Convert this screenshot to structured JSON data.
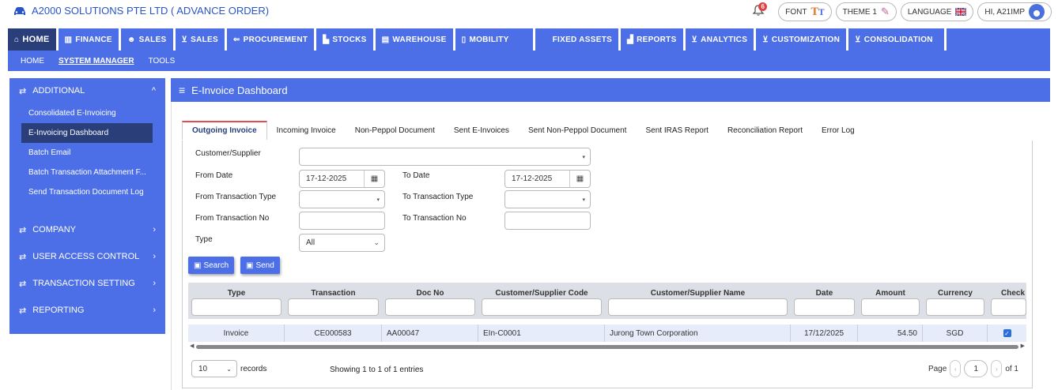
{
  "header": {
    "company": "A2000 SOLUTIONS PTE LTD ( ADVANCE ORDER)",
    "notification_count": "6",
    "font_label": "FONT",
    "theme_label": "THEME 1",
    "language_label": "LANGUAGE",
    "user_label": "HI, A21IMP"
  },
  "mainnav": [
    {
      "label": "HOME",
      "icon": "home-icon"
    },
    {
      "label": "FINANCE",
      "icon": "bank-icon"
    },
    {
      "label": "SALES",
      "icon": "users-icon"
    },
    {
      "label": "SALES",
      "icon": "cart-icon"
    },
    {
      "label": "PROCUREMENT",
      "icon": "procure-icon"
    },
    {
      "label": "STOCKS",
      "icon": "chart-icon"
    },
    {
      "label": "WAREHOUSE",
      "icon": "warehouse-icon"
    },
    {
      "label": "MOBILITY",
      "icon": "mobile-icon"
    },
    {
      "label": "FIXED ASSETS",
      "icon": ""
    },
    {
      "label": "REPORTS",
      "icon": "reports-icon"
    },
    {
      "label": "ANALYTICS",
      "icon": "cart-icon"
    },
    {
      "label": "CUSTOMIZATION",
      "icon": "cart-icon"
    },
    {
      "label": "CONSOLIDATION",
      "icon": "cart-icon"
    }
  ],
  "subnav": [
    "HOME",
    "SYSTEM MANAGER",
    "TOOLS"
  ],
  "sidebar": {
    "additional": "ADDITIONAL",
    "items": [
      "Consolidated E-Invoicing",
      "E-Invoicing Dashboard",
      "Batch Email",
      "Batch Transaction Attachment F...",
      "Send Transaction Document Log"
    ],
    "groups": [
      "COMPANY",
      "USER ACCESS CONTROL",
      "TRANSACTION SETTING",
      "REPORTING"
    ]
  },
  "panel_title": "E-Invoice Dashboard",
  "tabs": [
    "Outgoing Invoice",
    "Incoming Invoice",
    "Non-Peppol Document",
    "Sent E-Invoices",
    "Sent Non-Peppol Document",
    "Sent IRAS Report",
    "Reconciliation Report",
    "Error Log"
  ],
  "form": {
    "customer_supplier_label": "Customer/Supplier",
    "from_date_label": "From Date",
    "from_date_value": "17-12-2025",
    "to_date_label": "To Date",
    "to_date_value": "17-12-2025",
    "from_trans_type_label": "From Transaction Type",
    "to_trans_type_label": "To Transaction Type",
    "from_trans_no_label": "From Transaction No",
    "to_trans_no_label": "To Transaction No",
    "type_label": "Type",
    "type_value": "All",
    "search_label": "Search",
    "send_label": "Send"
  },
  "table": {
    "columns": [
      "Type",
      "Transaction",
      "Doc No",
      "Customer/Supplier Code",
      "Customer/Supplier Name",
      "Date",
      "Amount",
      "Currency",
      "Check"
    ],
    "rows": [
      {
        "type": "Invoice",
        "transaction": "CE000583",
        "doc_no": "AA00047",
        "code": "EIn-C0001",
        "name": "Jurong Town Corporation",
        "date": "17/12/2025",
        "amount": "54.50",
        "currency": "SGD",
        "checked": true
      }
    ]
  },
  "footer": {
    "page_size": "10",
    "records_label": "records",
    "showing": "Showing 1 to 1 of 1 entries",
    "page_label": "Page",
    "page_value": "1",
    "of_label": "of 1"
  }
}
